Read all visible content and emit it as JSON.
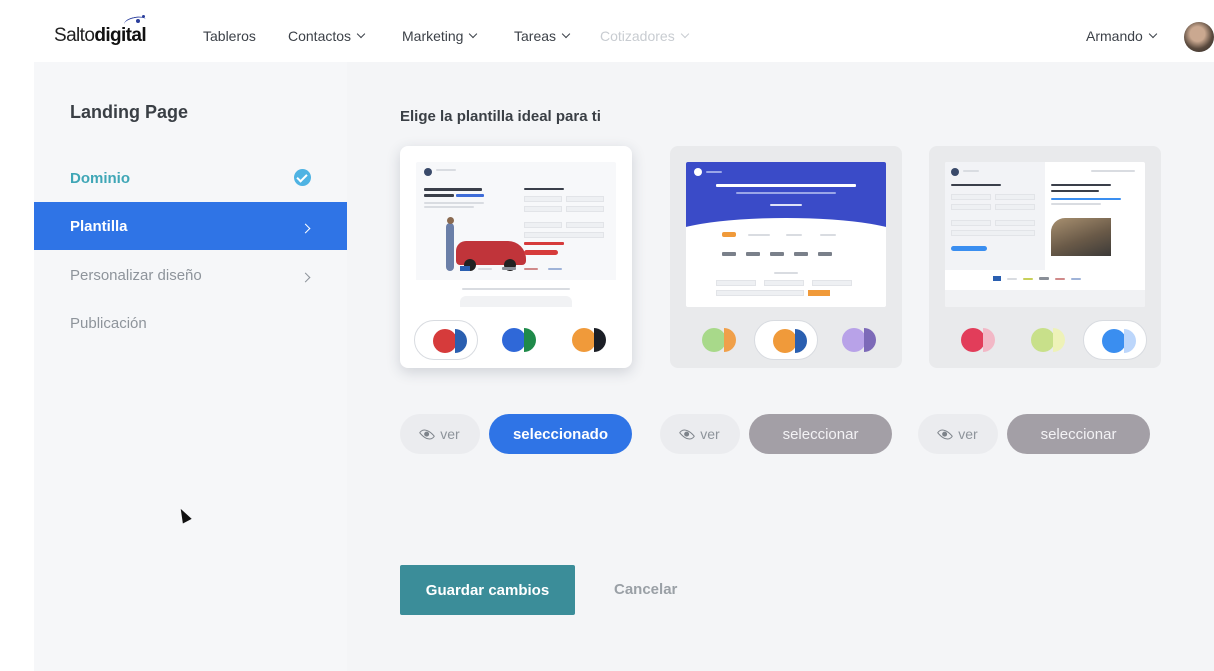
{
  "nav": {
    "logo_regular": "Salto",
    "logo_bold": "digital",
    "items": [
      "Tableros",
      "Contactos",
      "Marketing",
      "Tareas",
      "Cotizadores"
    ],
    "user": "Armando"
  },
  "sidebar": {
    "title": "Landing Page",
    "items": [
      {
        "label": "Dominio",
        "state": "done"
      },
      {
        "label": "Plantilla",
        "state": "active"
      },
      {
        "label": "Personalizar diseño",
        "state": "default"
      },
      {
        "label": "Publicación",
        "state": "default"
      }
    ]
  },
  "main": {
    "title": "Elige la plantilla ideal para ti",
    "view_label": "ver",
    "selected_label": "seleccionado",
    "select_label": "seleccionar",
    "save_label": "Guardar cambios",
    "cancel_label": "Cancelar"
  },
  "templates": [
    {
      "selected": true,
      "swatches": [
        {
          "a": "#d63b3b",
          "b": "#2a5fb0",
          "active": true
        },
        {
          "a": "#2f68d8",
          "b": "#1f8a4a",
          "active": false
        },
        {
          "a": "#f09a3a",
          "b": "#1c1f26",
          "active": false
        }
      ]
    },
    {
      "selected": false,
      "swatches": [
        {
          "a": "#a8d98a",
          "b": "#f0a04a",
          "active": false
        },
        {
          "a": "#f09a3a",
          "b": "#2a5fb0",
          "active": true
        },
        {
          "a": "#b8a2e8",
          "b": "#7d6ab8",
          "active": false
        }
      ]
    },
    {
      "selected": false,
      "swatches": [
        {
          "a": "#e23d5a",
          "b": "#f2b8c6",
          "active": false
        },
        {
          "a": "#c8e08a",
          "b": "#eef2b8",
          "active": false
        },
        {
          "a": "#3a8ef0",
          "b": "#bcd6fb",
          "active": true
        }
      ]
    }
  ]
}
